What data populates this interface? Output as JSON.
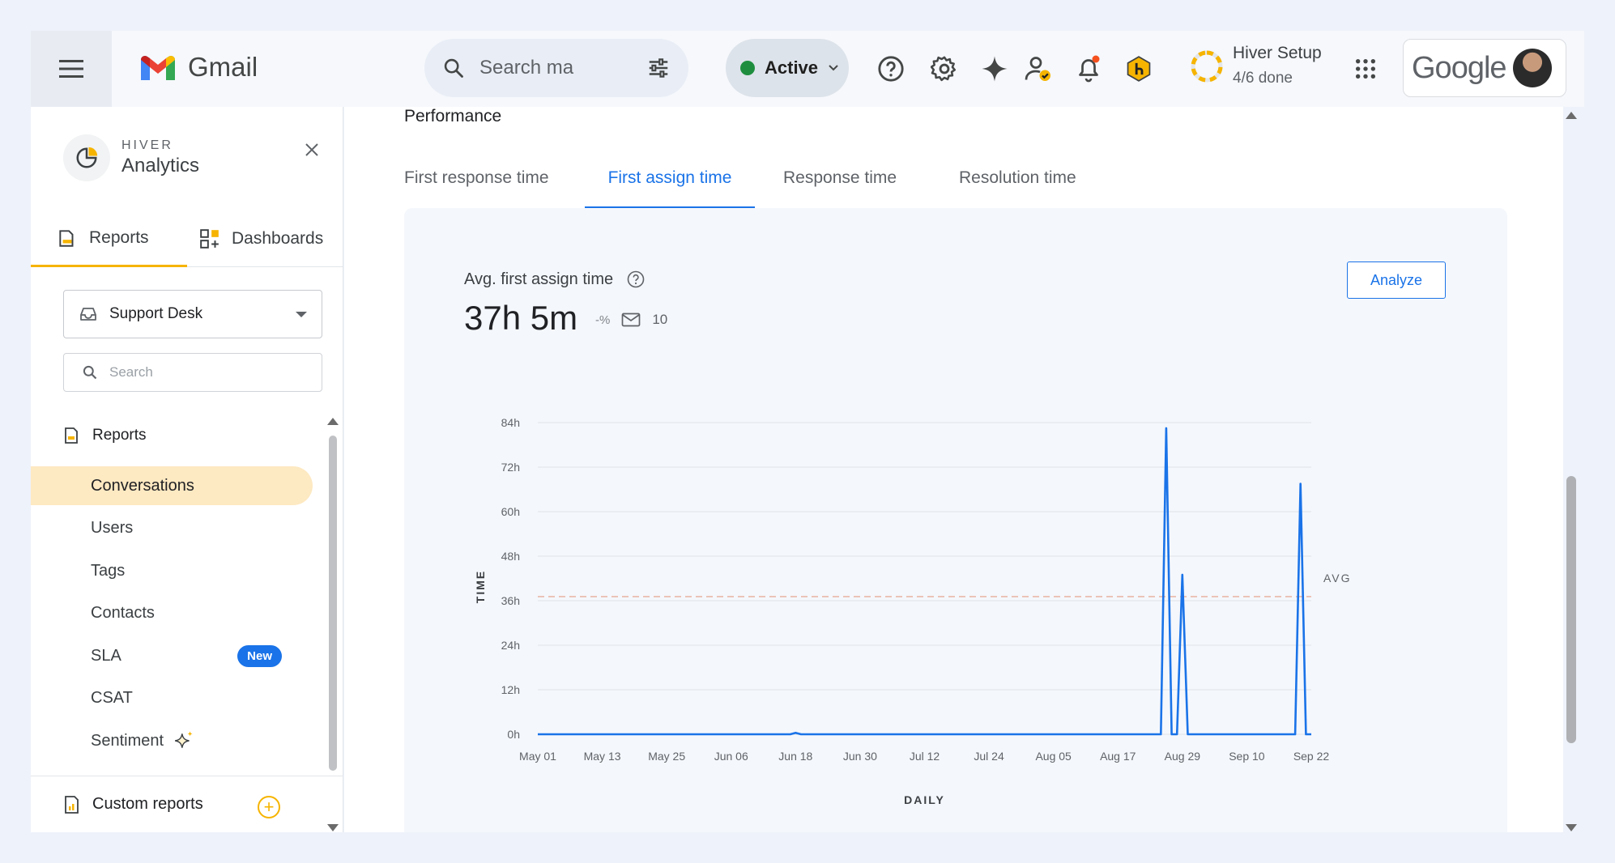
{
  "topbar": {
    "app_name": "Gmail",
    "search_placeholder": "Search ma",
    "status_label": "Active",
    "setup_title": "Hiver Setup",
    "setup_progress": "4/6 done",
    "account_brand": "Google"
  },
  "sidebar": {
    "brand_small": "HIVER",
    "brand_big": "Analytics",
    "tabs": [
      {
        "label": "Reports",
        "active": true
      },
      {
        "label": "Dashboards",
        "active": false
      }
    ],
    "inbox_selector": "Support Desk",
    "search_placeholder": "Search",
    "section_title": "Reports",
    "items": [
      {
        "label": "Conversations",
        "active": true
      },
      {
        "label": "Users"
      },
      {
        "label": "Tags"
      },
      {
        "label": "Contacts"
      },
      {
        "label": "SLA",
        "badge": "New"
      },
      {
        "label": "CSAT"
      },
      {
        "label": "Sentiment"
      }
    ],
    "custom_reports_label": "Custom reports"
  },
  "main": {
    "section_title": "Performance",
    "tabs": [
      {
        "label": "First response time",
        "active": false
      },
      {
        "label": "First assign time",
        "active": true
      },
      {
        "label": "Response time",
        "active": false
      },
      {
        "label": "Resolution time",
        "active": false
      }
    ],
    "metric_label": "Avg. first assign time",
    "metric_value": "37h 5m",
    "metric_change": "-%",
    "metric_count": "10",
    "analyze_label": "Analyze"
  },
  "colors": {
    "accent_blue": "#1a73e8",
    "active_green": "#1e8e3e",
    "highlight_yellow": "#fde9c2",
    "brand_yellow": "#f6b400",
    "avg_line": "#e8b9a8"
  },
  "chart_data": {
    "type": "line",
    "title": "",
    "xlabel": "DAILY",
    "ylabel": "TIME",
    "ylim": [
      0,
      84
    ],
    "y_ticks": [
      "0h",
      "12h",
      "24h",
      "36h",
      "48h",
      "60h",
      "72h",
      "84h"
    ],
    "x_tick_labels": [
      "May 01",
      "May 13",
      "May 25",
      "Jun 06",
      "Jun 18",
      "Jun 30",
      "Jul 12",
      "Jul 24",
      "Aug 05",
      "Aug 17",
      "Aug 29",
      "Sep 10",
      "Sep 22"
    ],
    "avg_label": "AVG",
    "avg_value": 37.1,
    "grid": true,
    "series": [
      {
        "points": [
          [
            "May 01",
            0
          ],
          [
            "Jun 17",
            0
          ],
          [
            "Jun 18",
            0.4
          ],
          [
            "Jun 19",
            0
          ],
          [
            "Aug 24",
            0
          ],
          [
            "Aug 25",
            0
          ],
          [
            "Aug 26",
            82.5
          ],
          [
            "Aug 27",
            0
          ],
          [
            "Aug 28",
            0
          ],
          [
            "Aug 29",
            43
          ],
          [
            "Aug 30",
            0
          ],
          [
            "Sep 18",
            0
          ],
          [
            "Sep 19",
            0
          ],
          [
            "Sep 20",
            67.5
          ],
          [
            "Sep 21",
            0
          ],
          [
            "Sep 22",
            0
          ]
        ]
      }
    ]
  }
}
